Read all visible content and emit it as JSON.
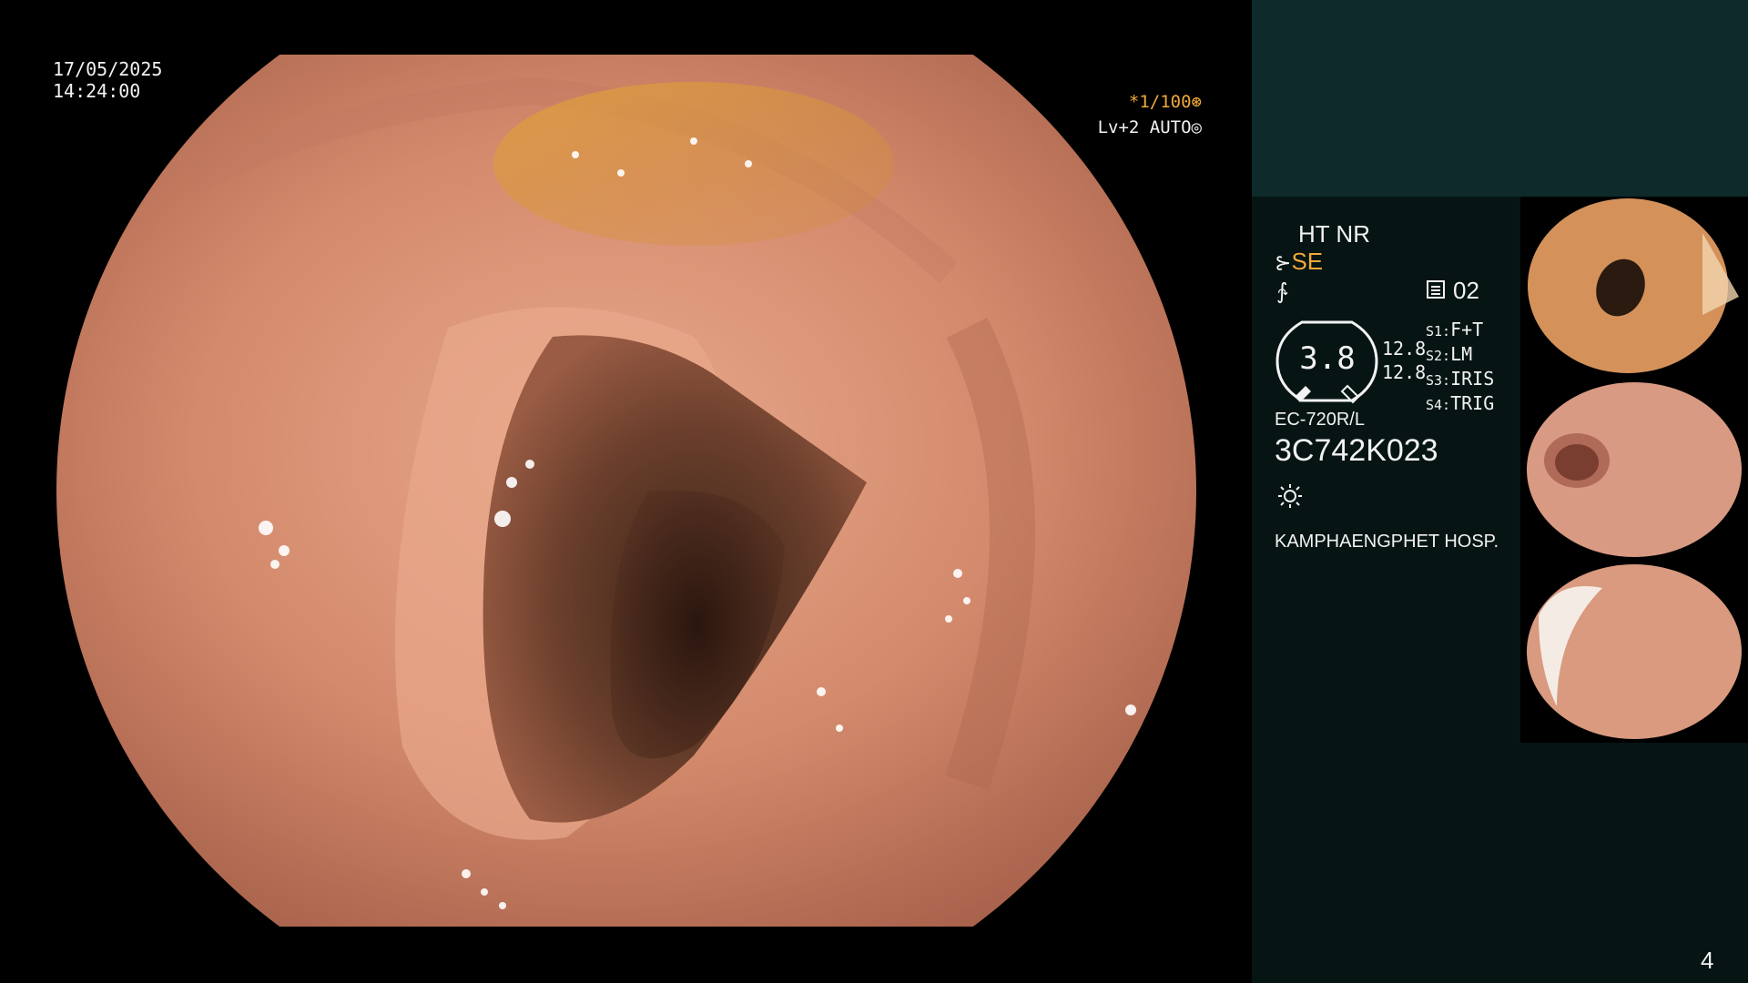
{
  "osd": {
    "date": "17/05/2025",
    "time": "14:24:00",
    "zoom": "*1/100",
    "level": "Lv+2 AUTO"
  },
  "panel": {
    "ht_nr": "HT NR",
    "se": "SE",
    "memory": "02",
    "gauge_value": "3.8",
    "range_1": "12.8",
    "range_2": "12.8",
    "s_items": [
      {
        "key": "S1:",
        "value": "F+T"
      },
      {
        "key": "S2:",
        "value": "LM"
      },
      {
        "key": "S3:",
        "value": "IRIS"
      },
      {
        "key": "S4:",
        "value": "TRIG"
      }
    ],
    "model": "EC-720R/L",
    "serial": "3C742K023",
    "hospital": "KAMPHAENGPHET HOSP."
  },
  "page_number": "4",
  "colors": {
    "zoom_accent": "#f0a93a",
    "panel_top": "#0e2a2a",
    "panel_main": "#061414",
    "mucosa": "#d98a6a"
  },
  "icons": {
    "zoom": "aperture-icon",
    "level": "iris-icon",
    "se": "scope-tip-icon",
    "wave": "wave-icon",
    "memory": "memory-card-icon",
    "light": "light-icon"
  }
}
